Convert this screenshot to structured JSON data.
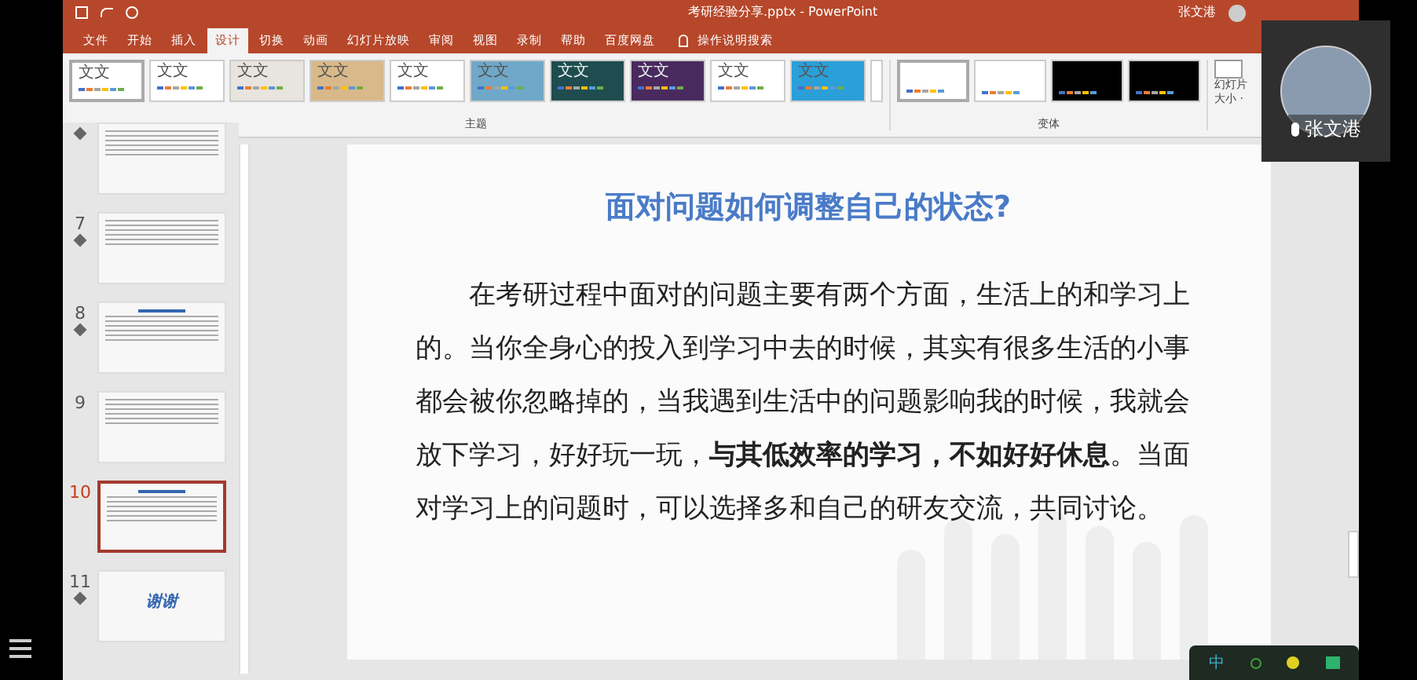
{
  "window": {
    "title": "考研经验分享.pptx  -  PowerPoint",
    "user": "张文港"
  },
  "ribbon_tabs": [
    {
      "label": "文件",
      "selected": false
    },
    {
      "label": "开始",
      "selected": false
    },
    {
      "label": "插入",
      "selected": false
    },
    {
      "label": "设计",
      "selected": true
    },
    {
      "label": "切换",
      "selected": false
    },
    {
      "label": "动画",
      "selected": false
    },
    {
      "label": "幻灯片放映",
      "selected": false
    },
    {
      "label": "审阅",
      "selected": false
    },
    {
      "label": "视图",
      "selected": false
    },
    {
      "label": "录制",
      "selected": false
    },
    {
      "label": "帮助",
      "selected": false
    },
    {
      "label": "百度网盘",
      "selected": false
    }
  ],
  "tell_me": "操作说明搜索",
  "themes": [
    {
      "label": "文文",
      "color": "#ffffff",
      "selected": true
    },
    {
      "label": "文文",
      "color": "#ffffff",
      "selected": false
    },
    {
      "label": "文文",
      "color": "#e8e4de",
      "selected": false
    },
    {
      "label": "文文",
      "color": "#d9b98a",
      "selected": false
    },
    {
      "label": "文文",
      "color": "#ffffff",
      "selected": false
    },
    {
      "label": "文文",
      "color": "#6fa8c8",
      "selected": false
    },
    {
      "label": "文文",
      "color": "#1f4d4f",
      "selected": false
    },
    {
      "label": "文文",
      "color": "#4a2a5e",
      "selected": false
    },
    {
      "label": "文文",
      "color": "#ffffff",
      "selected": false
    },
    {
      "label": "文文",
      "color": "#2a9fd8",
      "selected": false
    }
  ],
  "themes_group": "主题",
  "variants": [
    {
      "color": "#ffffff",
      "selected": true
    },
    {
      "color": "#ffffff",
      "selected": false
    },
    {
      "color": "#000000",
      "selected": false
    },
    {
      "color": "#000000",
      "selected": false
    }
  ],
  "variants_group": "变体",
  "slide_size": {
    "line_1": "幻灯片",
    "line_2": "大小 ·"
  },
  "thumbnails": [
    {
      "starred": true,
      "selected": false,
      "kind": "text"
    },
    {
      "number": "7",
      "starred": true,
      "selected": false,
      "kind": "text"
    },
    {
      "number": "8",
      "starred": true,
      "selected": false,
      "kind": "titled"
    },
    {
      "number": "9",
      "starred": false,
      "selected": false,
      "kind": "text"
    },
    {
      "number": "10",
      "starred": false,
      "selected": true,
      "kind": "titled"
    },
    {
      "number": "11",
      "starred": true,
      "selected": false,
      "kind": "thanks",
      "caption": "谢谢"
    }
  ],
  "slide": {
    "title": "面对问题如何调整自己的状态?",
    "body": "在考研过程中面对的问题主要有两个方面，生活上的和学习上的。当你全身心的投入到学习中去的时候，其实有很多生活的小事都会被你忽略掉的，当我遇到生活中的问题影响我的时候，我就会放下学习，好好玩一玩，**与其低效率的学习，不如好好休息**。当面对学习上的问题时，可以选择多和自己的研友交流，共同讨论。"
  },
  "video_tile": {
    "name": "张文港"
  },
  "ime_toolbar": {
    "mode": "中"
  }
}
